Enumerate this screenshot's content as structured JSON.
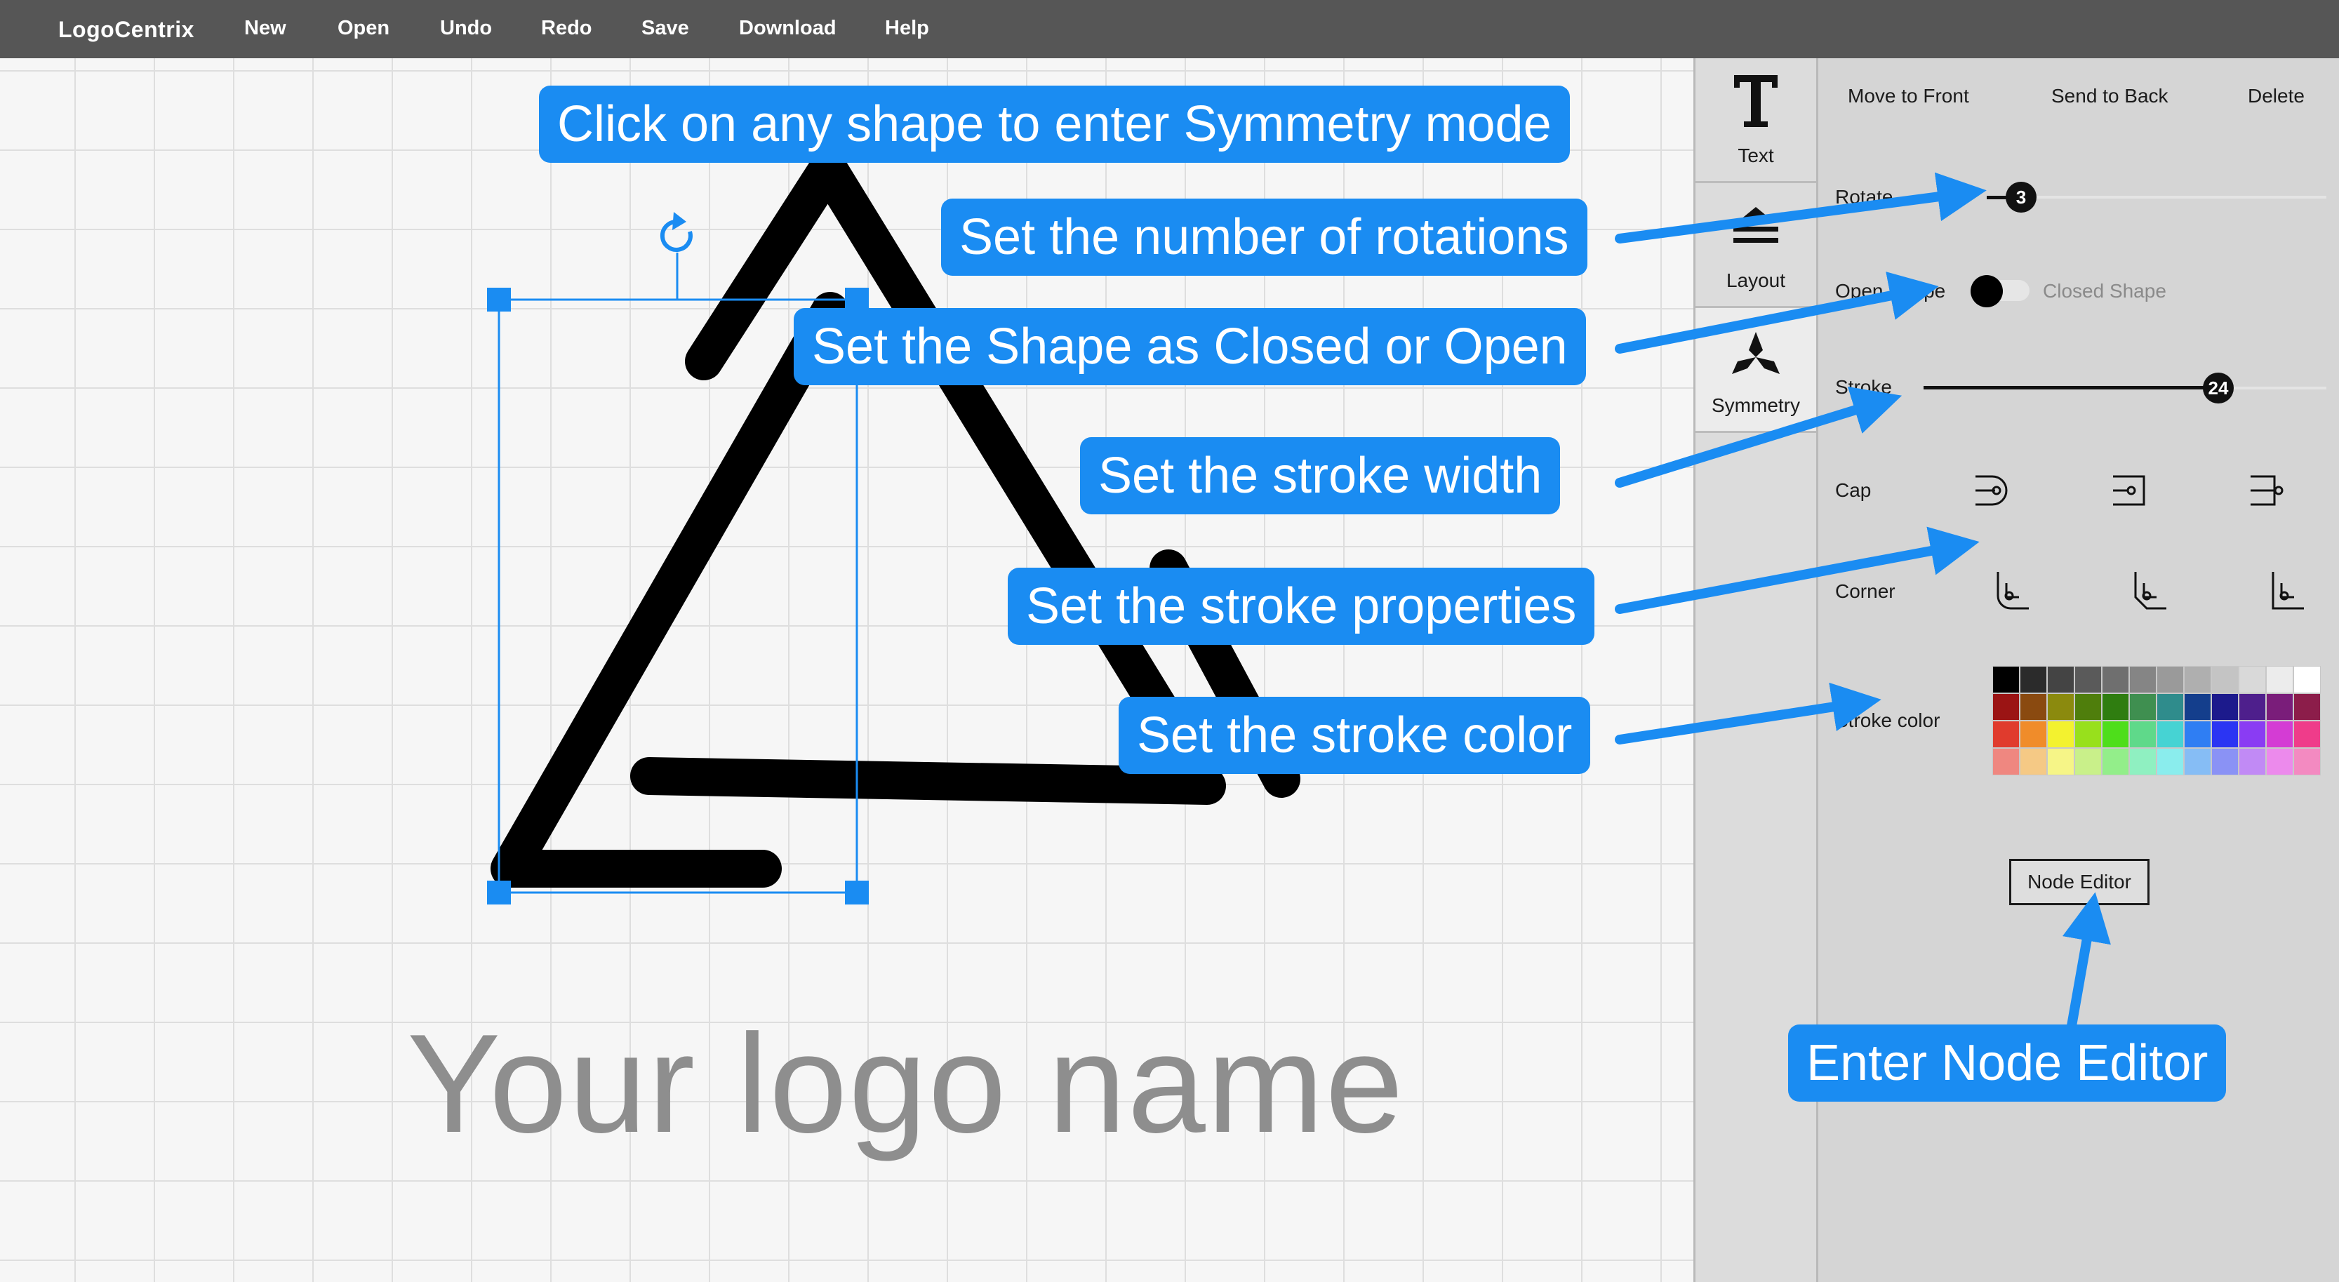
{
  "menubar": {
    "brand": "LogoCentrix",
    "items": [
      "New",
      "Open",
      "Undo",
      "Redo",
      "Save",
      "Download",
      "Help"
    ]
  },
  "canvas": {
    "logo_name": "Your logo name",
    "shape_color": "#000000",
    "selection_color": "#1a8cf2"
  },
  "tools": {
    "text": "Text",
    "layout": "Layout",
    "symmetry": "Symmetry",
    "active": "Symmetry"
  },
  "panel": {
    "move_to_front": "Move to Front",
    "send_to_back": "Send to Back",
    "delete": "Delete",
    "rotate_label": "Rotate",
    "rotate_value": "3",
    "open_shape_label": "Open Shape",
    "closed_shape_label": "Closed Shape",
    "stroke_label": "Stroke",
    "stroke_value": "24",
    "cap_label": "Cap",
    "corner_label": "Corner",
    "stroke_color_label": "Stroke color",
    "node_editor": "Node Editor",
    "palette": [
      "#000000",
      "#2b2b2b",
      "#444444",
      "#5a5a5a",
      "#6f6f6f",
      "#858585",
      "#9a9a9a",
      "#afafaf",
      "#c4c4c4",
      "#d9d9d9",
      "#ececec",
      "#ffffff",
      "#9b1414",
      "#8a4a10",
      "#8b8a0e",
      "#4f7e0c",
      "#2f7d10",
      "#3f8f50",
      "#2f8c8c",
      "#143e8c",
      "#1c1a8c",
      "#4e1f8c",
      "#7a1d7a",
      "#8c1d4a",
      "#e03b2d",
      "#f08c2a",
      "#f3f22f",
      "#98e01c",
      "#4ede1b",
      "#5fd98a",
      "#46d3d3",
      "#2f7ef3",
      "#2b35f3",
      "#8a3cf3",
      "#d43cd4",
      "#ef3c8a",
      "#ef8780",
      "#f5c985",
      "#f6f587",
      "#c9f08a",
      "#93ee8a",
      "#8ff0c1",
      "#8aeded",
      "#86bdf5",
      "#8a92f5",
      "#c18af5",
      "#ec8aec",
      "#f38ac1"
    ]
  },
  "callouts": {
    "symmetry": "Click on any shape to enter Symmetry mode",
    "rotations": "Set the number of rotations",
    "closed_open": "Set the Shape as Closed or Open",
    "stroke_width": "Set the stroke width",
    "stroke_props": "Set the stroke properties",
    "stroke_color": "Set the stroke color",
    "node_editor": "Enter Node Editor",
    "color": "#1a8cf2"
  }
}
